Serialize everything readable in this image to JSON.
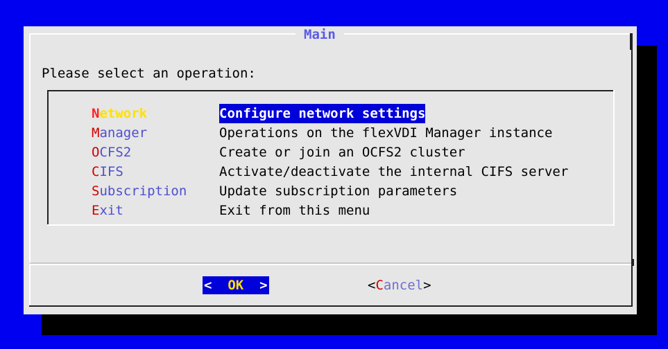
{
  "dialog": {
    "title": "Main",
    "prompt": "Please select an operation:"
  },
  "menu": {
    "items": [
      {
        "tag_hot": "N",
        "tag_rest": "etwork",
        "description": "Configure network settings",
        "selected": true
      },
      {
        "tag_hot": "M",
        "tag_rest": "anager",
        "description": "Operations on the flexVDI Manager instance",
        "selected": false
      },
      {
        "tag_hot": "O",
        "tag_rest": "CFS2",
        "description": "Create or join an OCFS2 cluster",
        "selected": false
      },
      {
        "tag_hot": "C",
        "tag_rest": "IFS",
        "description": "Activate/deactivate the internal CIFS server",
        "selected": false
      },
      {
        "tag_hot": "S",
        "tag_rest": "ubscription",
        "description": "Update subscription parameters",
        "selected": false
      },
      {
        "tag_hot": "E",
        "tag_rest": "xit",
        "description": "Exit from this menu",
        "selected": false
      }
    ]
  },
  "buttons": {
    "ok": {
      "left": "<  ",
      "hot": "OK",
      "right": "  >"
    },
    "cancel": {
      "left": "<",
      "hot": "C",
      "rest": "ancel",
      "right": ">"
    }
  },
  "colors": {
    "background": "#0000f0",
    "dialog": "#e6e6e6",
    "selection": "#0000d8",
    "hotkey": "#d10000",
    "tag": "#4f4fcf",
    "title": "#5a5ae6"
  }
}
